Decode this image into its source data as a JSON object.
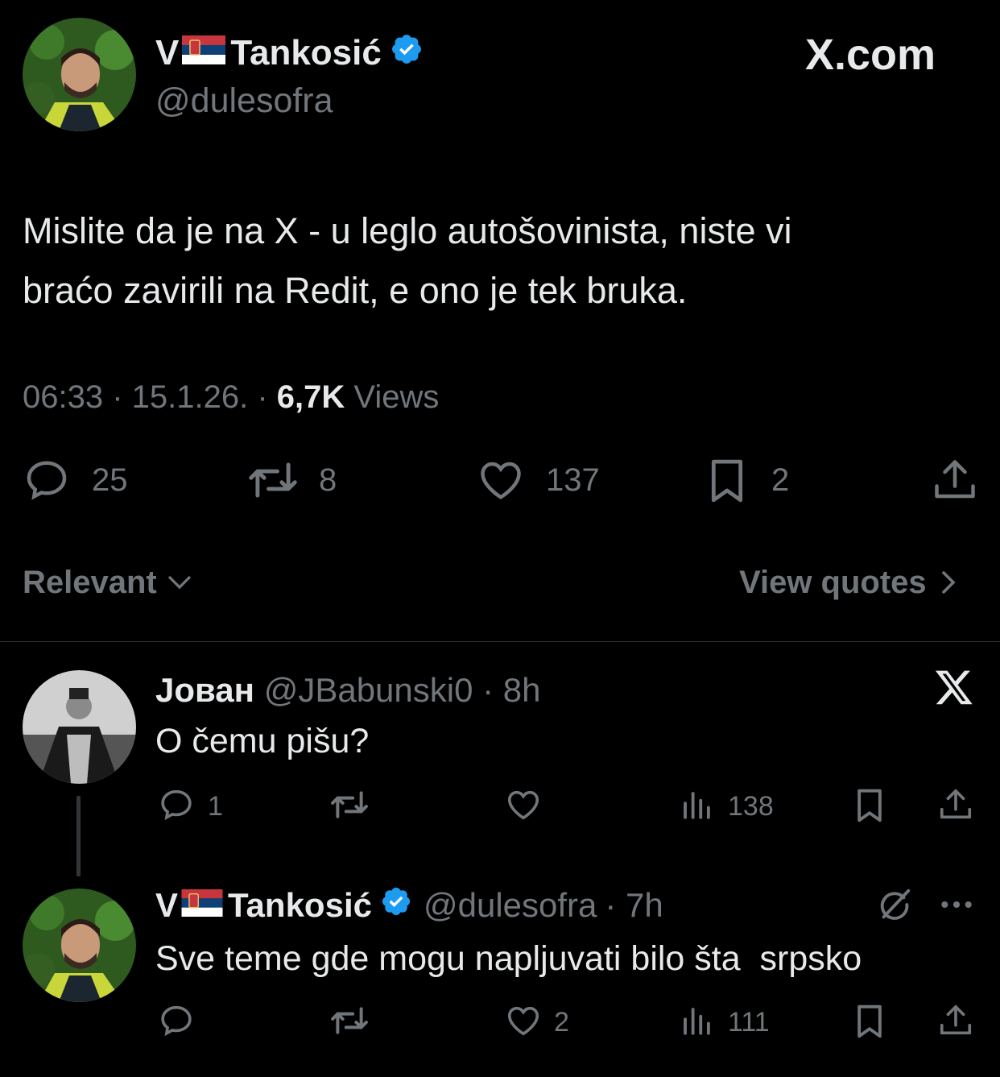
{
  "main_tweet": {
    "name_prefix": "V",
    "name_suffix": "Tankosić",
    "handle": "@dulesofra",
    "text_line1": "Mislite da je na X - u leglo autošovinista, niste vi",
    "text_line2": "braćo zavirili na Redit, e ono je tek bruka.",
    "time": "06:33 · 15.1.26. · ",
    "views_count": "6,7K",
    "views_label": " Views",
    "replies": "25",
    "reposts": "8",
    "likes": "137",
    "bookmarks": "2"
  },
  "brand": "X.com",
  "sort": {
    "label": "Relevant",
    "view_quotes": "View quotes"
  },
  "reply1": {
    "name": "Јован",
    "handle": "@JBabunski0",
    "time": "· 8h",
    "text": "O čemu pišu?",
    "replies": "1",
    "views": "138"
  },
  "reply2": {
    "name_prefix": "V",
    "name_suffix": "Tankosić",
    "handle": "@dulesofra",
    "time": "· 7h",
    "text": "Sve teme gde mogu napljuvati bilo šta  srpsko",
    "likes": "2",
    "views": "111"
  },
  "colors": {
    "background": "#000000",
    "text": "#e7e9ea",
    "muted": "#71767b",
    "verified": "#1d9bf0",
    "divider": "#2f3336"
  },
  "icons": [
    "reply-icon",
    "repost-icon",
    "like-icon",
    "bookmark-icon",
    "share-icon",
    "views-icon",
    "x-logo-icon",
    "grok-icon",
    "more-icon",
    "chevron-down-icon",
    "chevron-right-icon",
    "verified-icon",
    "serbia-flag-icon"
  ]
}
